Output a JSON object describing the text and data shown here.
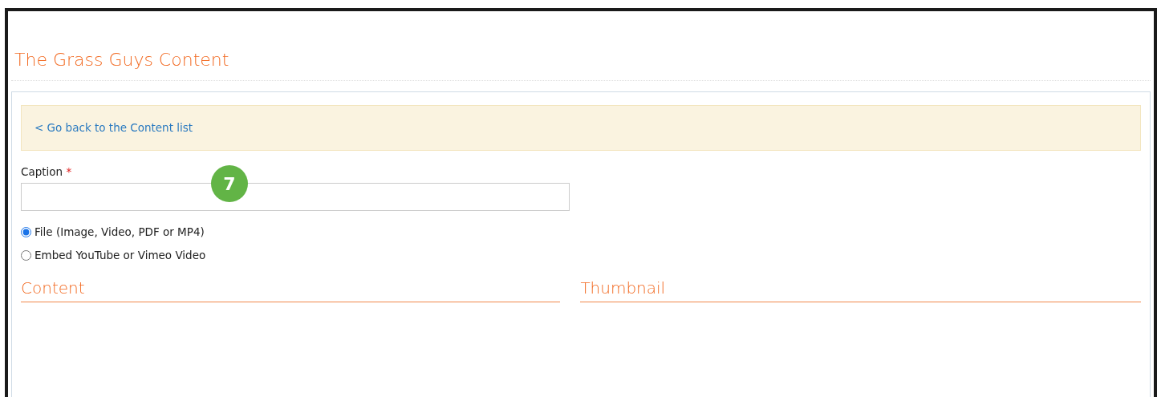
{
  "title": "The Grass Guys Content",
  "back_link": "< Go back to the Content list",
  "caption": {
    "label": "Caption",
    "required_mark": "*"
  },
  "step_badge": "7",
  "source_options": [
    {
      "label": "File (Image, Video, PDF or MP4)",
      "selected": true
    },
    {
      "label": "Embed YouTube or Vimeo Video",
      "selected": false
    }
  ],
  "sections": [
    "Content",
    "Thumbnail"
  ]
}
